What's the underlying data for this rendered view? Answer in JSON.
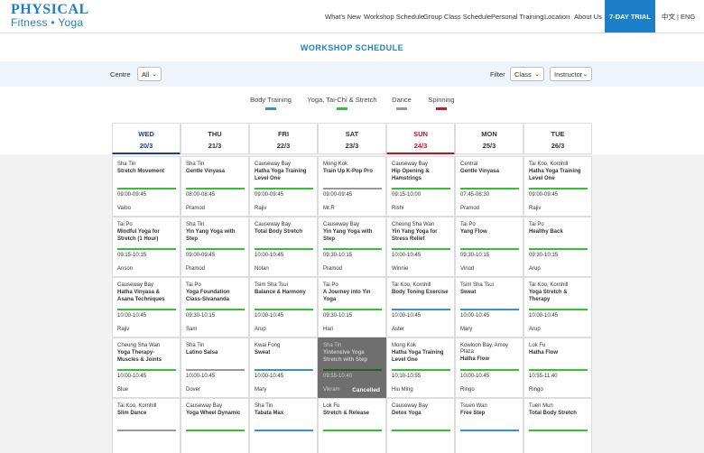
{
  "logo": {
    "line1": "PHYSICAL",
    "line2": "Fitness • Yoga"
  },
  "nav": [
    "What's New",
    "Workshop Schedule",
    "Group Class Schedule",
    "Personal Training",
    "Location",
    "About Us"
  ],
  "trial_label": "7-DAY TRIAL",
  "lang": {
    "zh": "中文",
    "sep": "|",
    "en": "ENG"
  },
  "page_title": "WORKSHOP SCHEDULE",
  "filters": {
    "centre_label": "Centre",
    "centre_value": "All",
    "filter_label": "Filter",
    "class_value": "Class",
    "instructor_value": "Instructor"
  },
  "legend": [
    {
      "label": "Body Training",
      "color": "#3a8fd6"
    },
    {
      "label": "Yoga, Tai-Chi & Stretch",
      "color": "#2fc42f"
    },
    {
      "label": "Dance",
      "color": "#999999"
    },
    {
      "label": "Spinning",
      "color": "#d0132b"
    }
  ],
  "days": [
    {
      "name": "WED",
      "date": "20/3"
    },
    {
      "name": "THU",
      "date": "21/3"
    },
    {
      "name": "FRI",
      "date": "22/3"
    },
    {
      "name": "SAT",
      "date": "23/3"
    },
    {
      "name": "SUN",
      "date": "24/3"
    },
    {
      "name": "MON",
      "date": "25/3"
    },
    {
      "name": "TUE",
      "date": "26/3"
    }
  ],
  "cancelled_label": "Cancelled",
  "rows": [
    [
      {
        "loc": "Sha Tin",
        "cls": "Stretch Movement",
        "time": "09:00-09:45",
        "inst": "Vaibo",
        "cat": "green"
      },
      {
        "loc": "Sha Tin",
        "cls": "Gentle Vinyasa",
        "time": "08:00-08:45",
        "inst": "Pramod",
        "cat": "green"
      },
      {
        "loc": "Causeway Bay",
        "cls": "Hatha Yoga Training Level One",
        "time": "09:00-09:45",
        "inst": "Rajiv",
        "cat": "green"
      },
      {
        "loc": "Mong Kok",
        "cls": "Train Up K-Pop Pro",
        "time": "09:00-09:45",
        "inst": "Mr.R",
        "cat": "gray"
      },
      {
        "loc": "Causeway Bay",
        "cls": "Hip Opening & Hamstrings",
        "time": "09:15-10:00",
        "inst": "Rishi",
        "cat": "green"
      },
      {
        "loc": "Central",
        "cls": "Gentle Vinyasa",
        "time": "07:45-08:30",
        "inst": "Pramod",
        "cat": "green"
      },
      {
        "loc": "Tai Koo, Kornhill",
        "cls": "Hatha Yoga Training Level One",
        "time": "09:00-09:45",
        "inst": "Rajiv",
        "cat": "green"
      }
    ],
    [
      {
        "loc": "Tai Po",
        "cls": "Mindful Yoga for Stretch (1 Hour)",
        "time": "09:15-10:15",
        "inst": "Anson",
        "cat": "green"
      },
      {
        "loc": "Sha Tin",
        "cls": "Yin Yang Yoga with Step",
        "time": "09:00-09:45",
        "inst": "Pramod",
        "cat": "green"
      },
      {
        "loc": "Causeway Bay",
        "cls": "Total Body Stretch",
        "time": "10:00-10:45",
        "inst": "Nolan",
        "cat": "green"
      },
      {
        "loc": "Causeway Bay",
        "cls": "Yin Yang Yoga with Step",
        "time": "09:30-10:15",
        "inst": "Pramod",
        "cat": "green"
      },
      {
        "loc": "Cheung Sha Wan",
        "cls": "Yin Yang Yoga for Stress Relief",
        "time": "10:00-10:45",
        "inst": "Winnie",
        "cat": "green"
      },
      {
        "loc": "Tai Po",
        "cls": "Yang Flow",
        "time": "09:30-10:15",
        "inst": "Vinod",
        "cat": "green"
      },
      {
        "loc": "Tai Po",
        "cls": "Healthy Back",
        "time": "09:30-10:15",
        "inst": "Arup",
        "cat": "green"
      }
    ],
    [
      {
        "loc": "Causeway Bay",
        "cls": "Hatha Vinyasa & Asana Techniques",
        "time": "10:00-10:45",
        "inst": "Rajiv",
        "cat": "green"
      },
      {
        "loc": "Tai Po",
        "cls": "Yoga Foundation Class-Sivananda",
        "time": "09:30-10:15",
        "inst": "Sam",
        "cat": "green"
      },
      {
        "loc": "Tsim Sha Tsui",
        "cls": "Balance & Harmony",
        "time": "10:00-10:45",
        "inst": "Arup",
        "cat": "green"
      },
      {
        "loc": "Tai Po",
        "cls": "A Journey into Yin Yoga",
        "time": "09:30-10:15",
        "inst": "Hari",
        "cat": "green"
      },
      {
        "loc": "Tai Koo, Kornhill",
        "cls": "Body Toning Exercise",
        "time": "10:00-10:45",
        "inst": "Aster",
        "cat": "blue"
      },
      {
        "loc": "Tsim Sha Tsui",
        "cls": "Sweat",
        "time": "10:00-10:45",
        "inst": "Mary",
        "cat": "blue"
      },
      {
        "loc": "Tai Koo, Kornhill",
        "cls": "Yoga Stretch & Therapy",
        "time": "10:00-10:45",
        "inst": "Arup",
        "cat": "green"
      }
    ],
    [
      {
        "loc": "Cheung Sha Wan",
        "cls": "Yoga Therapy-Muscles & Joints",
        "time": "10:00-10:45",
        "inst": "Blue",
        "cat": "green"
      },
      {
        "loc": "Sha Tin",
        "cls": "Latino Salsa",
        "time": "10:00-10:45",
        "inst": "Dover",
        "cat": "gray"
      },
      {
        "loc": "Kwai Fong",
        "cls": "Sweat",
        "time": "10:00-10:45",
        "inst": "Mary",
        "cat": "blue"
      },
      {
        "loc": "Sha Tin",
        "cls": "Yintensive Yoga Stretch with Step",
        "time": "09:55-10:40",
        "inst": "Vikram",
        "cat": "green",
        "cancelled": true
      },
      {
        "loc": "Mong Kok",
        "cls": "Hatha Yoga Training Level One",
        "time": "10:10-10:55",
        "inst": "Hiu Ming",
        "cat": "green"
      },
      {
        "loc": "Kowloon Bay, Amoy Plaza",
        "cls": "Hatha Flow",
        "time": "10:00-10:45",
        "inst": "Ringo",
        "cat": "green"
      },
      {
        "loc": "Lok Fu",
        "cls": "Hatha Flow",
        "time": "10:55-11:40",
        "inst": "Ringo",
        "cat": "green"
      }
    ],
    [
      {
        "loc": "Tai Koo, Kornhill",
        "cls": "Slim Dance",
        "time": "",
        "inst": "",
        "cat": "gray"
      },
      {
        "loc": "Causeway Bay",
        "cls": "Yoga Wheel Dynamic",
        "time": "",
        "inst": "",
        "cat": "green"
      },
      {
        "loc": "Sha Tin",
        "cls": "Tabata Max",
        "time": "",
        "inst": "",
        "cat": "blue"
      },
      {
        "loc": "Lok Fu",
        "cls": "Stretch & Release",
        "time": "",
        "inst": "",
        "cat": "green"
      },
      {
        "loc": "Causeway Bay",
        "cls": "Detox Yoga",
        "time": "",
        "inst": "",
        "cat": "green"
      },
      {
        "loc": "Tsuen Wan",
        "cls": "Free Step",
        "time": "",
        "inst": "",
        "cat": "blue"
      },
      {
        "loc": "Tuen Mun",
        "cls": "Total Body Stretch",
        "time": "",
        "inst": "",
        "cat": "green"
      }
    ]
  ]
}
